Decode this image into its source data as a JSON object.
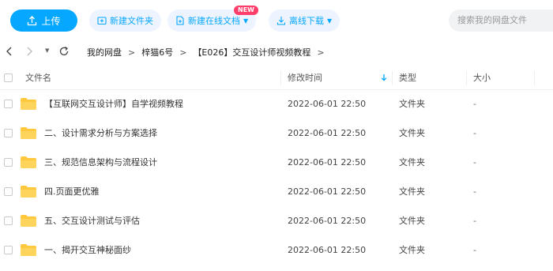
{
  "toolbar": {
    "upload_label": "上传",
    "new_folder_label": "新建文件夹",
    "new_online_doc_label": "新建在线文档",
    "new_badge": "NEW",
    "offline_download_label": "离线下载",
    "search_placeholder": "搜索我的网盘文件"
  },
  "breadcrumb": {
    "items": [
      "我的网盘",
      "梓猫6号",
      "【E026】交互设计师视频教程"
    ],
    "separator": ">"
  },
  "table": {
    "columns": {
      "name": "文件名",
      "modified": "修改时间",
      "type": "类型",
      "size": "大小"
    },
    "sort_column": "modified",
    "sort_direction": "descending",
    "rows": [
      {
        "name": "【互联网交互设计师】自学视频教程",
        "modified": "2022-06-01 22:50",
        "type": "文件夹",
        "size": "-"
      },
      {
        "name": "二、设计需求分析与方案选择",
        "modified": "2022-06-01 22:50",
        "type": "文件夹",
        "size": "-"
      },
      {
        "name": "三、规范信息架构与流程设计",
        "modified": "2022-06-01 22:50",
        "type": "文件夹",
        "size": "-"
      },
      {
        "name": "四.页面更优雅",
        "modified": "2022-06-01 22:50",
        "type": "文件夹",
        "size": "-"
      },
      {
        "name": "五、交互设计测试与评估",
        "modified": "2022-06-01 22:50",
        "type": "文件夹",
        "size": "-"
      },
      {
        "name": "一、揭开交互神秘面纱",
        "modified": "2022-06-01 22:50",
        "type": "文件夹",
        "size": "-"
      }
    ]
  },
  "colors": {
    "accent": "#06a7ff",
    "accent_light": "#eef4ff",
    "folder": "#ffc83d",
    "badge": "#ff3e6a"
  },
  "icons": [
    "upload-icon",
    "new-folder-icon",
    "new-doc-icon",
    "download-icon",
    "back-icon",
    "forward-icon",
    "history-dropdown-icon",
    "refresh-icon",
    "sort-down-icon",
    "folder-icon"
  ]
}
